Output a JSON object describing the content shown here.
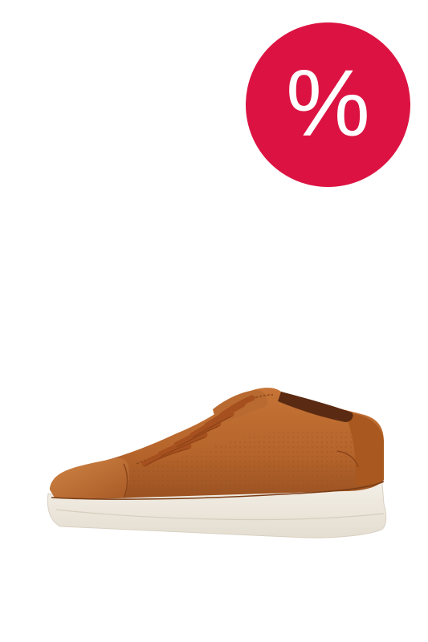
{
  "discount_badge": {
    "symbol": "%",
    "color": "#dc1342",
    "text_color": "#ffffff"
  },
  "product": {
    "icon": "sneaker-icon",
    "upper_color": "#b5642b",
    "sole_color": "#f1ece3",
    "lace_color": "#a5501e"
  },
  "background": "#ffffff"
}
